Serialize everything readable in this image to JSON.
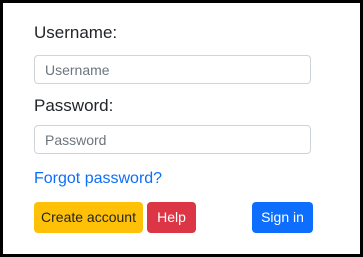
{
  "colors": {
    "create_account_bg": "#ffc107",
    "help_bg": "#dc3545",
    "sign_in_bg": "#0d6efd",
    "link": "#0d6efd",
    "border": "#000000"
  },
  "form": {
    "username_label": "Username:",
    "username_placeholder": "Username",
    "username_value": "",
    "password_label": "Password:",
    "password_placeholder": "Password",
    "password_value": "",
    "forgot_password": "Forgot password?",
    "create_account": "Create account",
    "help": "Help",
    "sign_in": "Sign in"
  }
}
